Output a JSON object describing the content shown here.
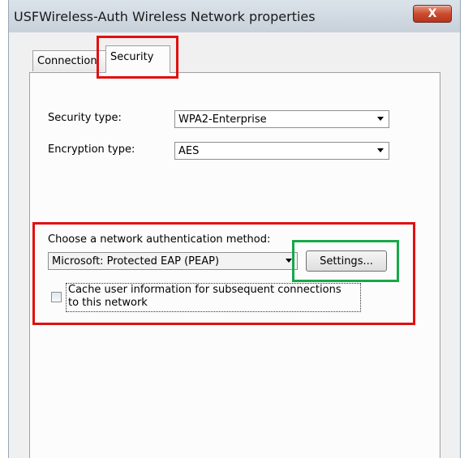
{
  "window": {
    "title": "USFWireless-Auth Wireless Network properties",
    "close_glyph": "X"
  },
  "tabs": [
    {
      "label": "Connection"
    },
    {
      "label": "Security"
    }
  ],
  "security": {
    "security_type_label": "Security type:",
    "security_type_value": "WPA2-Enterprise",
    "encryption_type_label": "Encryption type:",
    "encryption_type_value": "AES"
  },
  "auth": {
    "choose_label": "Choose a network authentication method:",
    "method_value": "Microsoft: Protected EAP (PEAP)",
    "settings_button": "Settings...",
    "cache_label_line1": "Cache user information for subsequent connections",
    "cache_label_line2": "to this network",
    "cache_checked": false
  },
  "annotations": {
    "red_color": "#e11010",
    "green_color": "#17a84a"
  }
}
